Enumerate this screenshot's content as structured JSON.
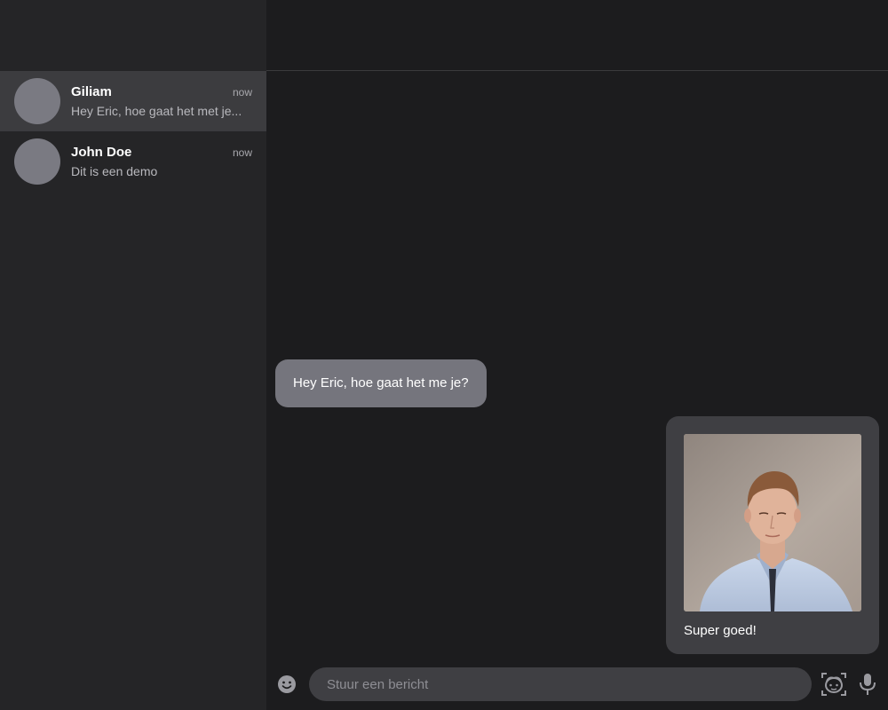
{
  "conversations": [
    {
      "name": "Giliam",
      "time": "now",
      "preview": "Hey Eric, hoe gaat het met je...",
      "active": true
    },
    {
      "name": "John Doe",
      "time": "now",
      "preview": "Dit is een demo",
      "active": false
    }
  ],
  "messages": {
    "received_text": "Hey Eric, hoe gaat het me je?",
    "sent_text": "Super goed!"
  },
  "composer": {
    "placeholder": "Stuur een bericht",
    "value": ""
  },
  "icons": {
    "emoji": "emoji-icon",
    "face_capture": "face-capture-icon",
    "microphone": "microphone-icon"
  },
  "colors": {
    "sidebar_bg": "#252527",
    "main_bg": "#1c1c1e",
    "active_item_bg": "#3c3c3f",
    "received_bubble": "#75757d",
    "sent_bubble": "#3f3f43"
  }
}
